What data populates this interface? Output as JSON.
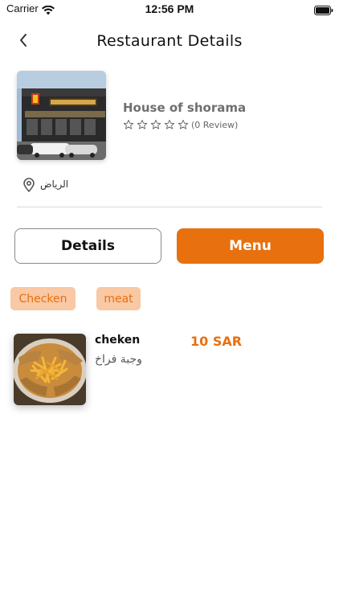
{
  "status_bar": {
    "carrier": "Carrier",
    "time": "12:56 PM"
  },
  "nav": {
    "title": "Restaurant Details",
    "back_icon": "chevron-left-icon"
  },
  "restaurant": {
    "name": "House of shorama",
    "rating_stars": 0,
    "review_text": "(0 Review)",
    "location": "الرياض"
  },
  "tabs": {
    "details_label": "Details",
    "menu_label": "Menu",
    "active": "Menu"
  },
  "categories": [
    {
      "label": "Checken"
    },
    {
      "label": "meat"
    }
  ],
  "menu_items": [
    {
      "name": "cheken",
      "description": "وجبة فراخ",
      "price": "10 SAR"
    }
  ],
  "colors": {
    "accent": "#e8700f",
    "chip_bg": "#f9c8a4",
    "title_gray": "#6f6f6f"
  }
}
